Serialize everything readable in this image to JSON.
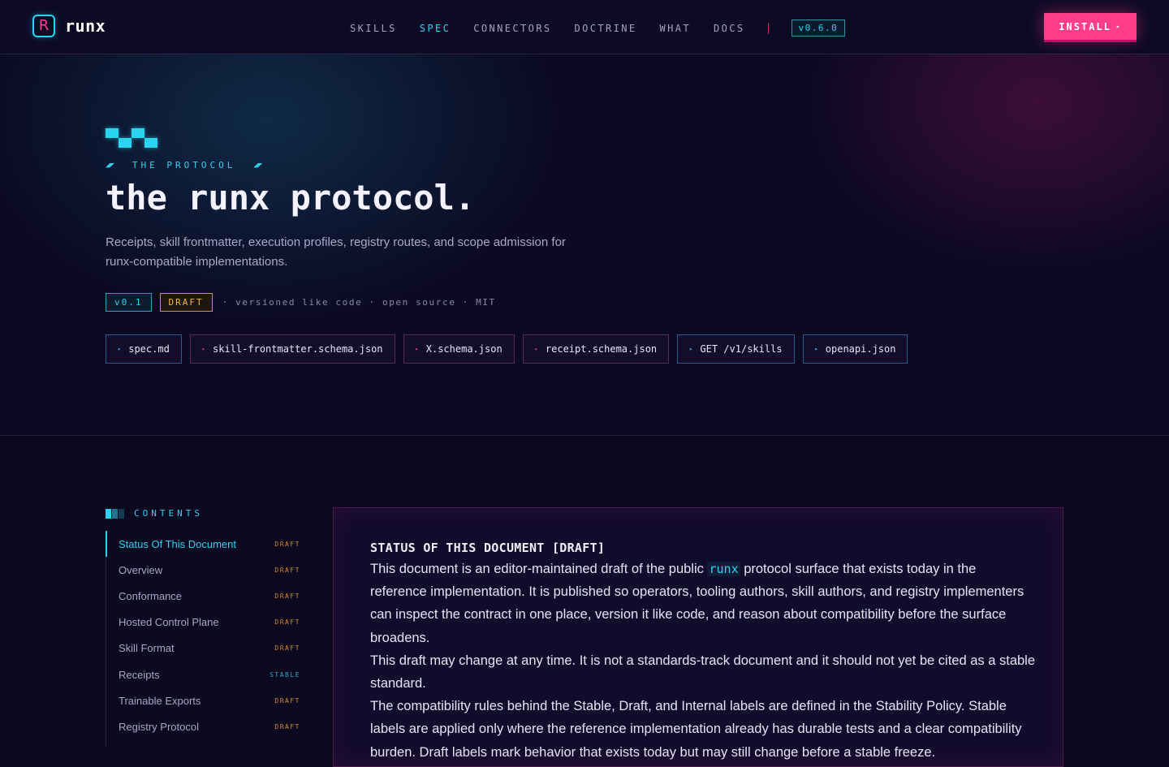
{
  "nav": {
    "brand_mark": "R",
    "brand_name": "runx",
    "links": [
      {
        "label": "SKILLS",
        "active": false
      },
      {
        "label": "SPEC",
        "active": true
      },
      {
        "label": "CONNECTORS",
        "active": false
      },
      {
        "label": "DOCTRINE",
        "active": false
      },
      {
        "label": "WHAT",
        "active": false
      },
      {
        "label": "DOCS",
        "active": false
      }
    ],
    "version": "v0.6.0",
    "install_label": "INSTALL",
    "install_arrow": "▸"
  },
  "hero": {
    "eyebrow": "THE PROTOCOL",
    "eyebrow_left": "◢◤",
    "eyebrow_right": "◢◤",
    "title": "the runx protocol.",
    "subtitle": "Receipts, skill frontmatter, execution profiles, registry routes, and scope admission for runx-compatible implementations.",
    "version_badge": "v0.1",
    "status_badge": "DRAFT",
    "meta": "· versioned like code · open source · MIT",
    "files": [
      {
        "label": "spec.md",
        "accent": "cyan"
      },
      {
        "label": "skill-frontmatter.schema.json",
        "accent": "pink"
      },
      {
        "label": "X.schema.json",
        "accent": "pink"
      },
      {
        "label": "receipt.schema.json",
        "accent": "pink"
      },
      {
        "label": "GET /v1/skills",
        "accent": "cyan"
      },
      {
        "label": "openapi.json",
        "accent": "cyan"
      }
    ],
    "file_bullet": "▸"
  },
  "toc": {
    "heading": "CONTENTS",
    "items": [
      {
        "label": "Status Of This Document",
        "tag": "DRAFT",
        "active": true
      },
      {
        "label": "Overview",
        "tag": "DRAFT",
        "active": false
      },
      {
        "label": "Conformance",
        "tag": "DRAFT",
        "active": false
      },
      {
        "label": "Hosted Control Plane",
        "tag": "DRAFT",
        "active": false
      },
      {
        "label": "Skill Format",
        "tag": "DRAFT",
        "active": false
      },
      {
        "label": "Receipts",
        "tag": "STABLE",
        "active": false
      },
      {
        "label": "Trainable Exports",
        "tag": "DRAFT",
        "active": false
      },
      {
        "label": "Registry Protocol",
        "tag": "DRAFT",
        "active": false
      }
    ]
  },
  "doc": {
    "title": "STATUS OF THIS DOCUMENT [DRAFT]",
    "p1_before": "This document is an editor-maintained draft of the public ",
    "p1_code": "runx",
    "p1_after": " protocol surface that exists today in the reference implementation. It is published so operators, tooling authors, skill authors, and registry implementers can inspect the contract in one place, version it like code, and reason about compatibility before the surface broadens.",
    "p2": "This draft may change at any time. It is not a standards-track document and it should not yet be cited as a stable standard.",
    "p3": "The compatibility rules behind the Stable, Draft, and Internal labels are defined in the Stability Policy. Stable labels are applied only where the reference implementation already has durable tests and a clear compatibility burden. Draft labels mark behavior that exists today but may still change before a stable freeze."
  },
  "colors": {
    "accent_cyan": "#2ad4f0",
    "accent_pink": "#ff3d8b",
    "draft_amber": "#f0b84a",
    "background": "#0b0820"
  }
}
